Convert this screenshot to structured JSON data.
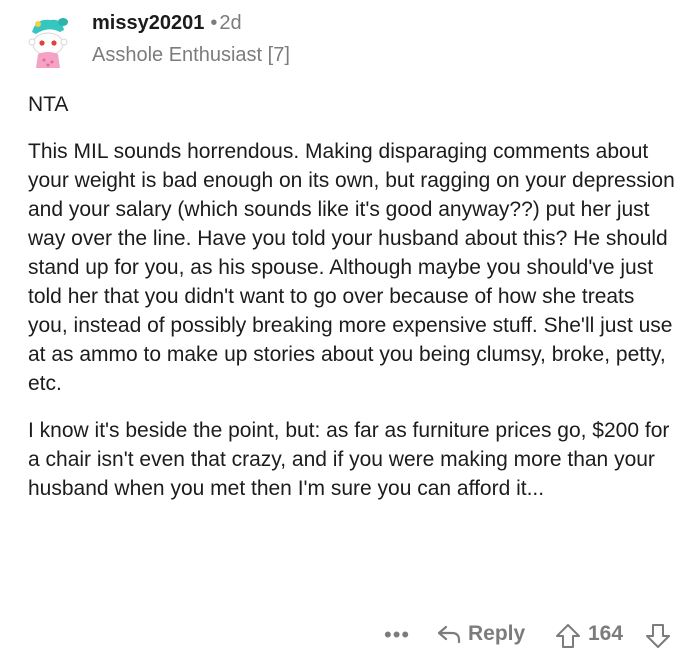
{
  "comment": {
    "username": "missy20201",
    "separator": "•",
    "age": "2d",
    "flair": "Asshole Enthusiast [7]",
    "paragraphs": [
      "NTA",
      "This MIL sounds horrendous. Making disparaging comments about your weight is bad enough on its own, but ragging on your depression and your salary (which sounds like it's good anyway??) put her just way over the line. Have you told your husband about this? He should stand up for you, as his spouse. Although maybe you should've just told her that you didn't want to go over because of how she treats you, instead of possibly breaking more expensive stuff. She'll just use at as ammo to make up stories about you being clumsy, broke, petty, etc.",
      "I know it's beside the point, but: as far as furniture prices go, $200 for a chair isn't even that crazy, and if you were making more than your husband when you met then I'm sure you can afford it..."
    ]
  },
  "actions": {
    "more": "•••",
    "reply_label": "Reply",
    "score": "164"
  },
  "icons": {
    "avatar": "snoo-avatar-icon",
    "reply": "reply-arrow-icon",
    "upvote": "upvote-arrow-icon",
    "downvote": "downvote-arrow-icon"
  },
  "colors": {
    "text": "#1c1c1c",
    "meta": "#7c7c7c",
    "background": "#ffffff"
  }
}
